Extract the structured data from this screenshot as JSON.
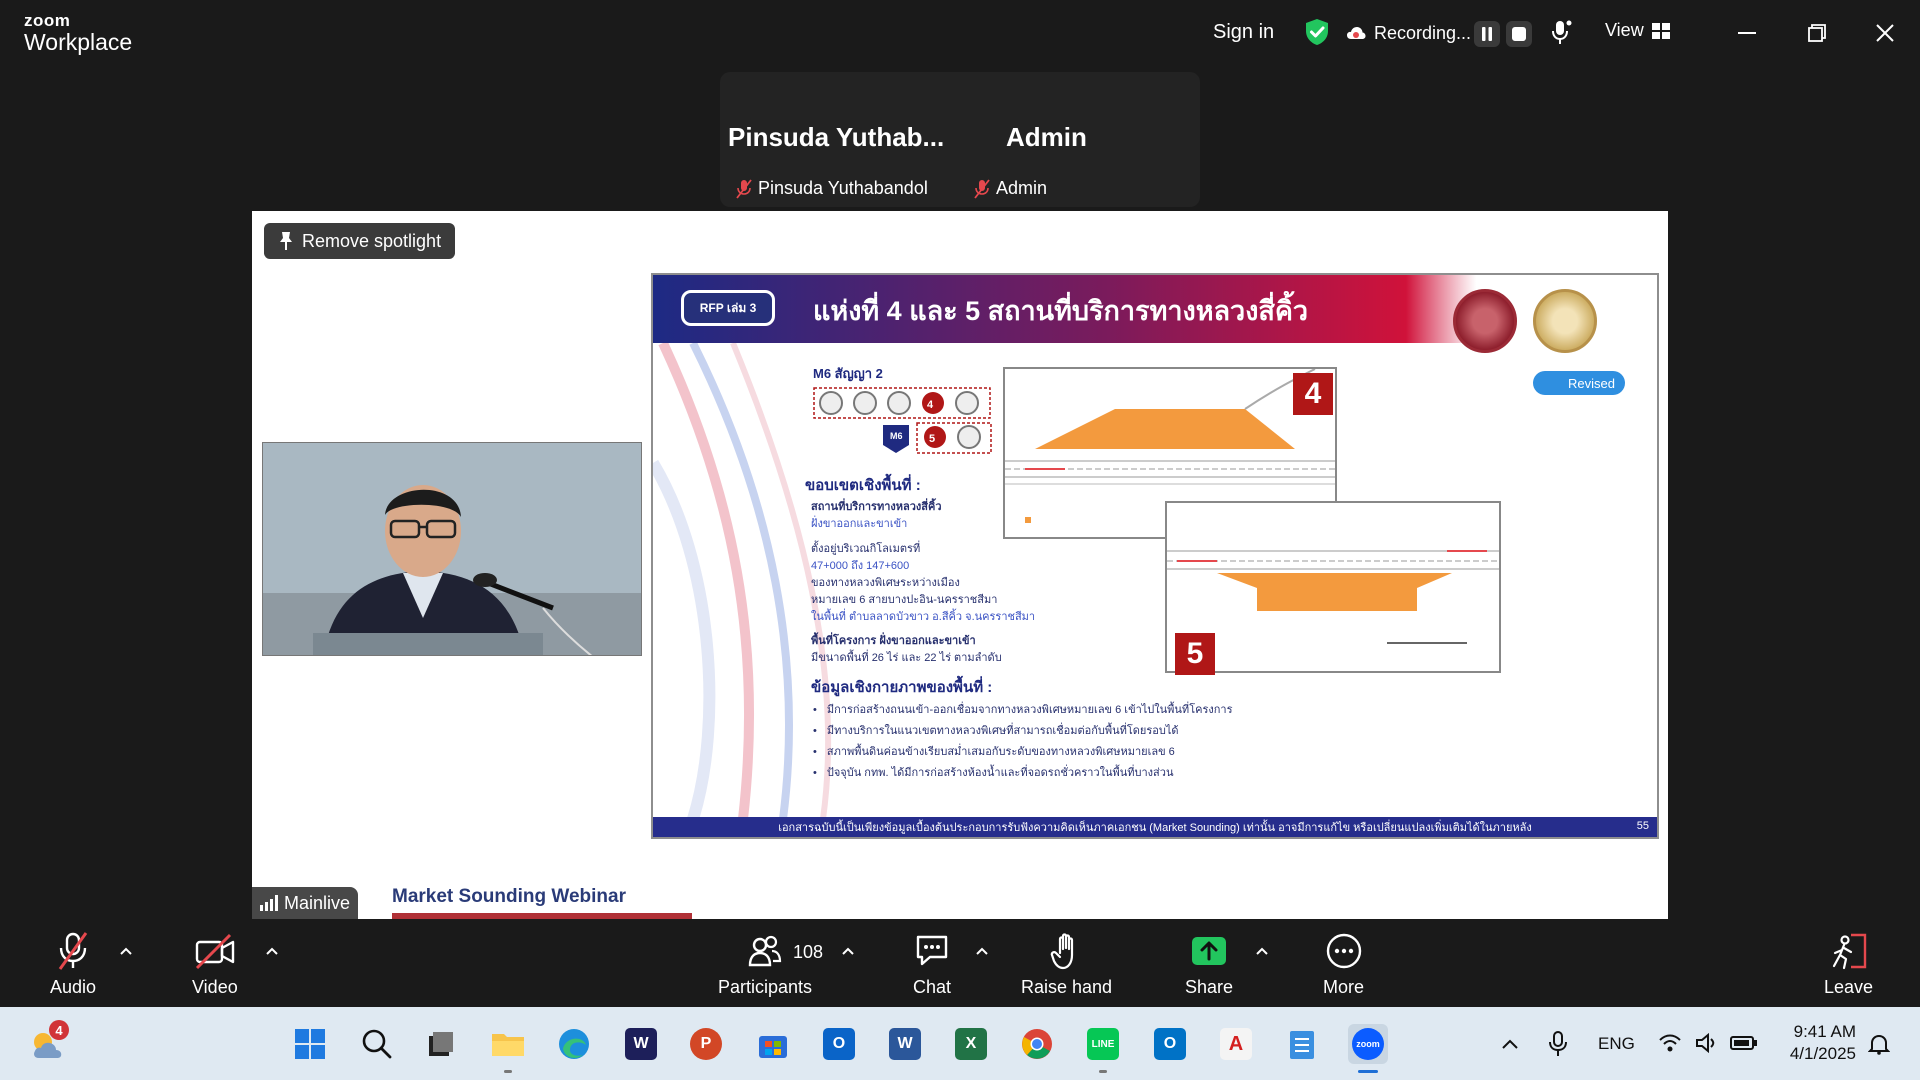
{
  "app": {
    "brand_top": "zoom",
    "brand_bottom": "Workplace"
  },
  "titlebar": {
    "sign_in": "Sign in",
    "recording": "Recording...",
    "view": "View"
  },
  "participants_strip": [
    {
      "big_name": "Pinsuda  Yuthab...",
      "name": "Pinsuda Yuthabandol",
      "muted": true
    },
    {
      "big_name": "Admin",
      "name": "Admin",
      "muted": true
    }
  ],
  "stage": {
    "remove_spotlight": "Remove spotlight",
    "stream_label": "Mainlive",
    "webinar_title": "Market Sounding Webinar"
  },
  "slide": {
    "badge": "RFP เล่ม 3",
    "title": "แห่งที่ 4 และ 5 สถานที่บริการทางหลวงสี่คิ้ว",
    "revised": "Revised",
    "contract": "M6 สัญญา 2",
    "motorway_badge": "M6",
    "site_numbers": [
      "4",
      "5"
    ],
    "scope_heading": "ขอบเขตเชิงพื้นที่ :",
    "scope_lines": [
      "สถานที่บริการทางหลวงสี่คิ้ว",
      "ฝั่งขาออกและขาเข้า",
      "ตั้งอยู่บริเวณกิโลเมตรที่",
      "47+000 ถึง 147+600",
      "ของทางหลวงพิเศษระหว่างเมือง",
      "หมายเลข 6 สายบางปะอิน-นครราชสีมา",
      "ในพื้นที่ ตำบลลาดบัวขาว อ.สีคิ้ว จ.นครราชสีมา",
      "พื้นที่โครงการ ฝั่งขาออกและขาเข้า",
      "มีขนาดพื้นที่ 26 ไร่ และ 22 ไร่ ตามลำดับ"
    ],
    "physical_heading": "ข้อมูลเชิงกายภาพของพื้นที่ :",
    "bullets": [
      "มีการก่อสร้างถนนเข้า-ออกเชื่อมจากทางหลวงพิเศษหมายเลข 6 เข้าไปในพื้นที่โครงการ",
      "มีทางบริการในแนวเขตทางหลวงพิเศษที่สามารถเชื่อมต่อกับพื้นที่โดยรอบได้",
      "สภาพพื้นดินค่อนข้างเรียบสม่ำเสมอกับระดับของทางหลวงพิเศษหมายเลข 6",
      "ปัจจุบัน กทพ. ได้มีการก่อสร้างห้องน้ำและที่จอดรถชั่วคราวในพื้นที่บางส่วน"
    ],
    "footer": "เอกสารฉบับนี้เป็นเพียงข้อมูลเบื้องต้นประกอบการรับฟังความคิดเห็นภาคเอกชน (Market Sounding) เท่านั้น อาจมีการแก้ไข หรือเปลี่ยนแปลงเพิ่มเติมได้ในภายหลัง",
    "page": "55"
  },
  "controls": {
    "audio": "Audio",
    "video": "Video",
    "participants": "Participants",
    "participant_count": "108",
    "chat": "Chat",
    "raise_hand": "Raise hand",
    "share": "Share",
    "more": "More",
    "leave": "Leave"
  },
  "taskbar": {
    "weather_badge": "4",
    "lang": "ENG",
    "time": "9:41 AM",
    "date": "4/1/2025"
  },
  "colors": {
    "zoom_blue": "#0b5cff",
    "share_green": "#22c55e",
    "muted_red": "#e5484d",
    "slide_navy": "#262d8c",
    "slide_red": "#c8102e"
  }
}
